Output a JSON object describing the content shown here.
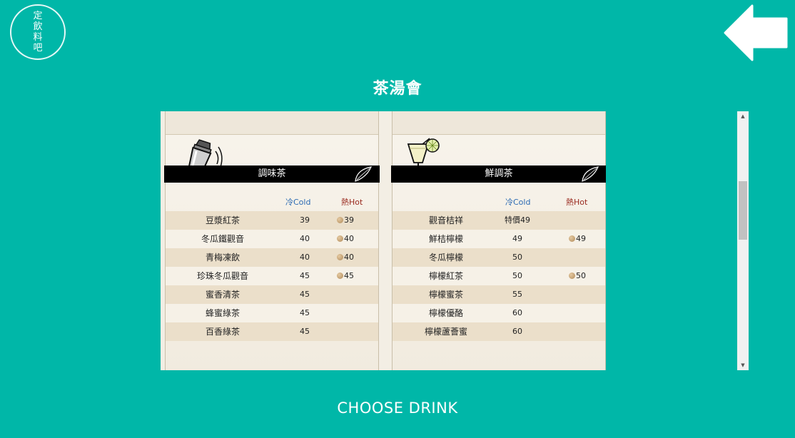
{
  "logo": {
    "lines": [
      "定",
      "飲",
      "料",
      "吧"
    ]
  },
  "header": {
    "title": "茶湯會"
  },
  "menu": {
    "left": {
      "category": "調味茶",
      "cold_label": "冷Cold",
      "hot_label": "熱Hot",
      "items": [
        {
          "name": "豆漿紅茶",
          "cold": "39",
          "hot": "39"
        },
        {
          "name": "冬瓜鐵觀音",
          "cold": "40",
          "hot": "40"
        },
        {
          "name": "青梅凍飲",
          "cold": "40",
          "hot": "40"
        },
        {
          "name": "珍珠冬瓜觀音",
          "cold": "45",
          "hot": "45"
        },
        {
          "name": "蜜香清茶",
          "cold": "45",
          "hot": ""
        },
        {
          "name": "蜂蜜綠茶",
          "cold": "45",
          "hot": ""
        },
        {
          "name": "百香綠茶",
          "cold": "45",
          "hot": ""
        }
      ]
    },
    "right": {
      "category": "鮮調茶",
      "cold_label": "冷Cold",
      "hot_label": "熱Hot",
      "items": [
        {
          "name": "觀音桔祥",
          "cold": "特價49",
          "hot": ""
        },
        {
          "name": "鮮桔檸檬",
          "cold": "49",
          "hot": "49"
        },
        {
          "name": "冬瓜檸檬",
          "cold": "50",
          "hot": ""
        },
        {
          "name": "檸檬紅茶",
          "cold": "50",
          "hot": "50"
        },
        {
          "name": "檸檬蜜茶",
          "cold": "55",
          "hot": ""
        },
        {
          "name": "檸檬優酪",
          "cold": "60",
          "hot": ""
        },
        {
          "name": "檸檬蘆薈蜜",
          "cold": "60",
          "hot": ""
        }
      ]
    }
  },
  "footer": {
    "choose_label": "CHOOSE DRINK"
  },
  "colors": {
    "background": "#00b7a8",
    "cold": "#2b6ab3",
    "hot": "#9a2a1f"
  },
  "icons": {
    "back": "back-arrow-icon",
    "left_category": "shaker-icon",
    "right_category": "cocktail-glass-icon"
  }
}
